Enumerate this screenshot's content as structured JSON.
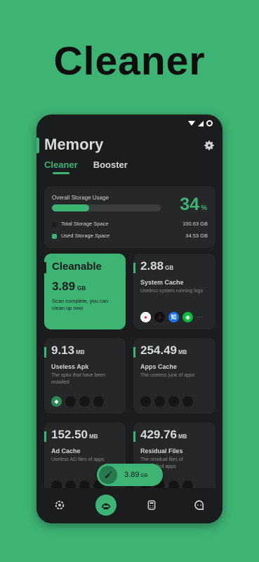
{
  "promo": {
    "title": "Cleaner"
  },
  "header": {
    "title": "Memory"
  },
  "tabs": [
    {
      "label": "Cleaner",
      "active": true
    },
    {
      "label": "Booster",
      "active": false
    }
  ],
  "storage": {
    "label": "Overall Storage Usage",
    "percent": "34",
    "percent_unit": "%",
    "usage_fraction": 0.34,
    "total_label": "Total Storage Space",
    "total_value": "100.63 GB",
    "used_label": "Used Storage Space",
    "used_value": "34.53 GB"
  },
  "cleanable": {
    "title": "Cleanable",
    "size": "3.89",
    "unit": "GB",
    "description": "Scan complete, you can clean up now"
  },
  "cards": {
    "system_cache": {
      "size": "2.88",
      "unit": "GB",
      "title": "System Cache",
      "description": "Useless system running logs",
      "app_icons": [
        "app-red-icon",
        "tiktok-icon",
        "zhihu-icon",
        "wechat-icon"
      ],
      "more": "···"
    },
    "useless_apk": {
      "size": "9.13",
      "unit": "MB",
      "title": "Useless Apk",
      "description": "The apks that have been installed"
    },
    "apps_cache": {
      "size": "254.49",
      "unit": "MB",
      "title": "Apps Cache",
      "description": "The useless junk of apps"
    },
    "ad_cache": {
      "size": "152.50",
      "unit": "MB",
      "title": "Ad Cache",
      "description": "Useless AD files of apps"
    },
    "residual_files": {
      "size": "429.76",
      "unit": "MB",
      "title": "Residual Files",
      "description": "The residual files of uninstalled apps"
    }
  },
  "float_pill": {
    "value": "3.89",
    "unit": "GB"
  },
  "nav": {
    "items": [
      "cleaner-nav-icon",
      "memory-nav-icon",
      "calculator-nav-icon",
      "chat-nav-icon"
    ]
  },
  "colors": {
    "background": "#3db374",
    "accent": "#3db374",
    "card": "#262729",
    "phone": "#1b1c1e"
  }
}
